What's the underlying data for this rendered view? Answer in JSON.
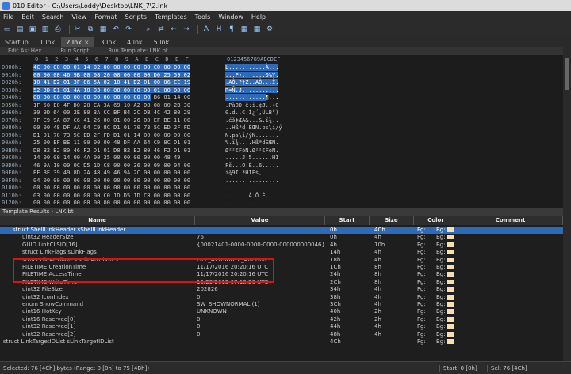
{
  "window": {
    "title": "010 Editor - C:\\Users\\Loddy\\Desktop\\LNK_7\\2.lnk"
  },
  "menu": [
    "File",
    "Edit",
    "Search",
    "View",
    "Format",
    "Scripts",
    "Templates",
    "Tools",
    "Window",
    "Help"
  ],
  "tabs": [
    {
      "label": "Startup",
      "active": false
    },
    {
      "label": "1.lnk",
      "active": false
    },
    {
      "label": "2.lnk",
      "active": true,
      "close": "×"
    },
    {
      "label": "3.lnk",
      "active": false
    },
    {
      "label": "4.lnk",
      "active": false
    },
    {
      "label": "5.lnk",
      "active": false
    }
  ],
  "subbar": {
    "edit_as": "Edit As: Hex",
    "run_script": "Run Script",
    "run_template": "Run Template: LNK.bt"
  },
  "hex": {
    "header": "0  1  2  3  4  5  6  7  8  9  A  B  C  D  E  F",
    "text_header": "0123456789ABCDEF",
    "rows": [
      {
        "off": "0000h:",
        "bytes": "4C 00 00 00 01 14 02 00 00 00 00 00 C0 00 00 00",
        "text": "L...........À...",
        "sel": 16
      },
      {
        "off": "0010h:",
        "bytes": "00 00 00 46 9B 00 08 20 00 00 00 00 D0 25 59 02",
        "text": "...F›.. ....Ð%Y.",
        "sel": 16
      },
      {
        "off": "0020h:",
        "bytes": "10 41 D2 01 3F 86 5A 02 10 41 D2 01 00 06 CE 19",
        "text": ".AÒ.?†Z..AÒ...Î.",
        "sel": 16
      },
      {
        "off": "0030h:",
        "bytes": "52 3D D1 01 4A 18 03 00 00 00 00 00 01 00 00 00",
        "text": "R=Ñ.J...........",
        "sel": 16
      },
      {
        "off": "0040h:",
        "bytes": "00 00 00 00 00 00 00 00 00 00 00 00 B6 01 14 00",
        "text": "............¶...",
        "sel": 12
      },
      {
        "off": "0050h:",
        "bytes": "1F 50 E0 4F D0 20 EA 3A 69 10 A2 D8 08 00 2B 30",
        "text": ".PàOÐ ê:i.¢Ø..+0",
        "sel": 0
      },
      {
        "off": "0060h:",
        "bytes": "30 9D 64 00 2E 80 3A CC BF B4 2C DB 4C 42 B0 29",
        "text": "0.d..€:Ì¿´,ÛLB°)",
        "sel": 0
      },
      {
        "off": "0070h:",
        "bytes": "7F E9 9A 87 C6 41 26 00 01 00 26 00 EF BE 11 00",
        "text": ".éš‡ÆA&...&.ï¾..",
        "sel": 0
      },
      {
        "off": "0080h:",
        "bytes": "00 00 48 DF AA 64 C9 8C D1 01 70 73 5C ED 2F FD",
        "text": "..Hßªd ÉŒÑ.ps\\í/ý",
        "sel": 0
      },
      {
        "off": "0090h:",
        "bytes": "D1 01 70 73 5C ED 2F FD D1 01 14 00 00 00 00 00",
        "text": "Ñ.ps\\í/ýÑ.......",
        "sel": 0
      },
      {
        "off": "00A0h:",
        "bytes": "25 00 EF BE 11 00 00 00 48 DF AA 64 C9 8C D1 01",
        "text": "%.ï¾....HßªdÉŒÑ.",
        "sel": 0
      },
      {
        "off": "00B0h:",
        "bytes": "D8 B2 B2 80 46 F2 D1 01 D8 B2 B2 80 46 F2 D1 01",
        "text": "Ø²²€FòÑ.Ø²²€FòÑ.",
        "sel": 0
      },
      {
        "off": "00C0h:",
        "bytes": "14 00 00 14 00 4A 00 35 00 00 00 00 00 48 49",
        "text": ".....J.5......HI",
        "sel": 0
      },
      {
        "off": "00D0h:",
        "bytes": "46 9A 10 00 0C D5 1D C8 00 00 36 00 09 00 04 00",
        "text": "Fš...Õ.È..6.....",
        "sel": 0
      },
      {
        "off": "00E0h:",
        "bytes": "EF BE 39 49 8D 2A 48 49 46 9A 2C 00 00 00 00 00",
        "text": "ï¾9I.*HIFš,.....",
        "sel": 0
      },
      {
        "off": "00F0h:",
        "bytes": "04 00 00 00 06 00 00 00 00 00 00 00 00 00 00 00",
        "text": "................",
        "sel": 0
      },
      {
        "off": "0100h:",
        "bytes": "00 00 00 00 00 00 00 00 00 00 00 00 00 00 00 00",
        "text": "................",
        "sel": 0
      },
      {
        "off": "0110h:",
        "bytes": "03 00 00 00 00 00 00 C0 1D D5 1D C8 00 00 00 00",
        "text": ".......À.Õ.È....",
        "sel": 0
      },
      {
        "off": "0120h:",
        "bytes": "00 00 00 00 00 00 00 00 00 00 00 00 00 00 00 00",
        "text": "................",
        "sel": 0
      }
    ]
  },
  "template": {
    "title": "Template Results - LNK.bt",
    "columns": {
      "name": "Name",
      "value": "Value",
      "start": "Start",
      "size": "Size",
      "color": "Color",
      "comment": "Comment"
    },
    "rows": [
      {
        "indent": 1,
        "name": "struct ShellLinkHeader sShellLinkHeader",
        "value": "",
        "start": "0h",
        "size": "4Ch",
        "fg": "Fg:",
        "bg": "Bg:",
        "selected": true
      },
      {
        "indent": 2,
        "name": "uint32 HeaderSize",
        "value": "76",
        "start": "0h",
        "size": "4h",
        "fg": "Fg:",
        "bg": "Bg:"
      },
      {
        "indent": 2,
        "name": "GUID LinkCLSID[16]",
        "value": "{00021401-0000-0000-C000-000000000046}",
        "start": "4h",
        "size": "10h",
        "fg": "Fg:",
        "bg": "Bg:"
      },
      {
        "indent": 2,
        "name": "struct LinkFlags sLinkFlags",
        "value": "",
        "start": "14h",
        "size": "4h",
        "fg": "Fg:",
        "bg": "Bg:"
      },
      {
        "indent": 2,
        "name": "struct FileAttributes sFileAttributes",
        "value": "FILE_ATTRIBUTE_ARCHIVE",
        "start": "18h",
        "size": "4h",
        "fg": "Fg:",
        "bg": "Bg:"
      },
      {
        "indent": 2,
        "name": "FILETIME CreationTime",
        "value": "11/17/2016 20:20:16 UTC",
        "start": "1Ch",
        "size": "8h",
        "fg": "Fg:",
        "bg": "Bg:"
      },
      {
        "indent": 2,
        "name": "FILETIME AccessTime",
        "value": "11/17/2016 20:20:16 UTC",
        "start": "24h",
        "size": "8h",
        "fg": "Fg:",
        "bg": "Bg:"
      },
      {
        "indent": 2,
        "name": "FILETIME WriteTime",
        "value": "12/23/2015 07:18:20 UTC",
        "start": "2Ch",
        "size": "8h",
        "fg": "Fg:",
        "bg": "Bg:"
      },
      {
        "indent": 2,
        "name": "uint32 FileSize",
        "value": "202826",
        "start": "34h",
        "size": "4h",
        "fg": "Fg:",
        "bg": "Bg:"
      },
      {
        "indent": 2,
        "name": "uint32 IconIndex",
        "value": "0",
        "start": "38h",
        "size": "4h",
        "fg": "Fg:",
        "bg": "Bg:"
      },
      {
        "indent": 2,
        "name": "enum ShowCommand",
        "value": "SW_SHOWNORMAL (1)",
        "start": "3Ch",
        "size": "4h",
        "fg": "Fg:",
        "bg": "Bg:"
      },
      {
        "indent": 2,
        "name": "uint16 HotKey",
        "value": "UNKNOWN",
        "start": "40h",
        "size": "2h",
        "fg": "Fg:",
        "bg": "Bg:"
      },
      {
        "indent": 2,
        "name": "uint16 Reserved[0]",
        "value": "0",
        "start": "42h",
        "size": "2h",
        "fg": "Fg:",
        "bg": "Bg:"
      },
      {
        "indent": 2,
        "name": "uint32 Reserved[1]",
        "value": "0",
        "start": "44h",
        "size": "4h",
        "fg": "Fg:",
        "bg": "Bg:"
      },
      {
        "indent": 2,
        "name": "uint32 Reserved[2]",
        "value": "0",
        "start": "48h",
        "size": "4h",
        "fg": "Fg:",
        "bg": "Bg:"
      },
      {
        "indent": 0,
        "name": "struct LinkTargetIDList sLinkTargetIDList",
        "value": "",
        "start": "4Ch",
        "size": "",
        "fg": "Fg:",
        "bg": "Bg:"
      }
    ]
  },
  "status": {
    "selected": "Selected: 76 [4Ch] bytes (Range: 0 [0h] to 75 [4Bh])",
    "start": "Start: 0 [0h]",
    "sel": "Sel: 76 [4Ch]"
  },
  "colors": {
    "selection": "#2d6bb8",
    "highlight_box": "#e01010",
    "bg_swatch": "#f5deb3"
  },
  "toolbar_icons": [
    "new-icon",
    "open-icon",
    "save-icon",
    "save-all-icon",
    "print-icon",
    "cut-icon",
    "copy-icon",
    "paste-icon",
    "undo-icon",
    "redo-icon",
    "find-icon",
    "replace-icon",
    "go-back-icon",
    "go-forward-icon",
    "font-icon",
    "hex-icon",
    "paragraph-icon",
    "grid-icon",
    "calculator-icon",
    "settings-icon"
  ]
}
